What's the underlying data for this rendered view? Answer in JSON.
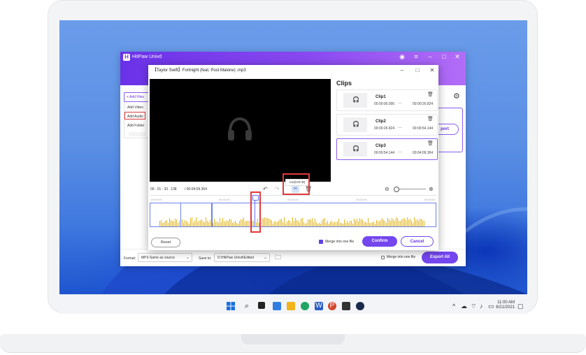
{
  "app": {
    "title": "HitPaw Univd",
    "add_files_label": "+ Add Files",
    "add_menu": [
      "Add Video",
      "Add Audio",
      "Add Folder"
    ],
    "export_partial_label": "port"
  },
  "dialog": {
    "title": "【Taylor Swift】Fortnight (feat. Post Malone) .mp3",
    "clips_title": "Clips",
    "clips": [
      {
        "name": "Clip1",
        "start": "00:00:00.000",
        "end": "00:00:26.824"
      },
      {
        "name": "Clip2",
        "start": "00:00:26.824",
        "end": "00:00:54.144"
      },
      {
        "name": "Clip3",
        "start": "00:00:54.144",
        "end": "00:04:09.364"
      }
    ],
    "time_current": "00 : 01 : 33 . 138",
    "time_total": "/ 00:04:09.364",
    "tooltip": "Cut(Ctrl+B)",
    "ruler_labels": [
      "00:00:00",
      "00:01:00",
      "00:02:00",
      "00:03:00",
      "00:04:00"
    ],
    "reset_label": "Reset",
    "merge_label": "Merge into one file",
    "confirm_label": "Confirm",
    "cancel_label": "Cancel"
  },
  "footer": {
    "format_label": "Format:",
    "format_value": "MP3-Same as source",
    "save_to_label": "Save to:",
    "save_to_value": "D:\\HitPaw Univd\\Edited",
    "merge_label": "Merge into one file",
    "export_all_label": "Export All"
  },
  "taskbar": {
    "time": "11:00 AM",
    "date": "6/21/2021"
  },
  "colors": {
    "accent": "#7446ee",
    "waveform": "#e2b51e",
    "highlight": "#e03a3a"
  }
}
